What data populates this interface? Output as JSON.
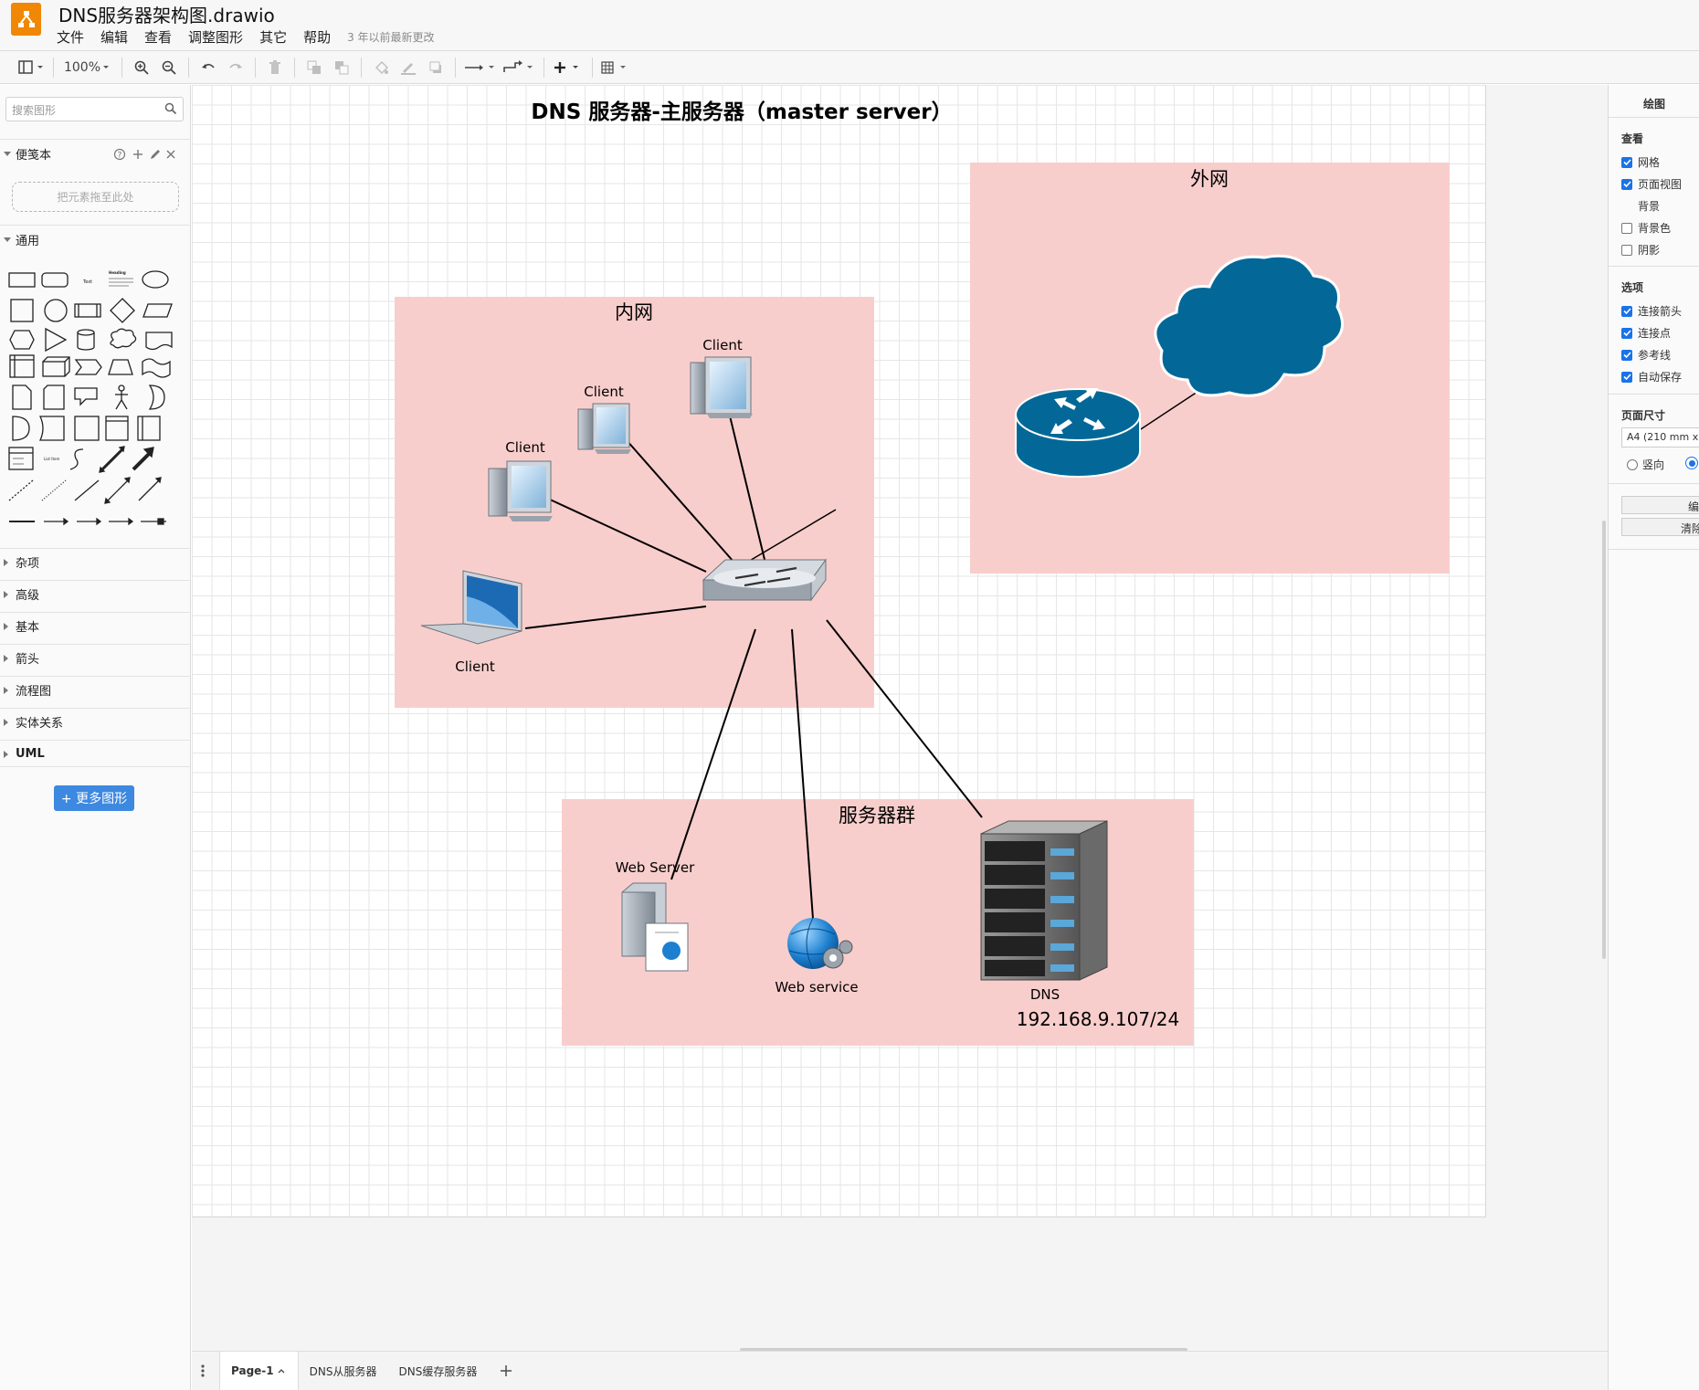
{
  "app": {
    "doc_title": "DNS服务器架构图.drawio",
    "menu": [
      "文件",
      "编辑",
      "查看",
      "调整图形",
      "其它",
      "帮助"
    ],
    "last_modified": "3 年以前最新更改"
  },
  "toolbar": {
    "zoom": "100%"
  },
  "sidebar": {
    "search_placeholder": "搜索图形",
    "scratchpad_label": "便笺本",
    "scratchpad_drop": "把元素拖至此处",
    "general_label": "通用",
    "sections": [
      "杂项",
      "高级",
      "基本",
      "箭头",
      "流程图",
      "实体关系",
      "UML"
    ],
    "more_shapes": "+ 更多图形",
    "text_shape_label": "Text",
    "heading_shape_label": "Heading",
    "list_shape_label": "List Item"
  },
  "diagram": {
    "title": "DNS 服务器-主服务器（master server）",
    "inner_net": "内网",
    "outer_net": "外网",
    "server_group": "服务器群",
    "client_label": "Client",
    "web_server_label": "Web Server",
    "web_service_label": "Web service",
    "dns_label": "DNS",
    "dns_ip": "192.168.9.107/24",
    "container_color": "#f8cecc",
    "device_color": "#036897"
  },
  "right_panel": {
    "title": "绘图",
    "view_heading": "查看",
    "view_options": [
      {
        "label": "网格",
        "checked": true
      },
      {
        "label": "页面视图",
        "checked": true
      }
    ],
    "background_label": "背景",
    "bg_options": [
      {
        "label": "背景色",
        "checked": false
      },
      {
        "label": "阴影",
        "checked": false
      }
    ],
    "options_heading": "选项",
    "options": [
      {
        "label": "连接箭头",
        "checked": true
      },
      {
        "label": "连接点",
        "checked": true
      },
      {
        "label": "参考线",
        "checked": true
      },
      {
        "label": "自动保存",
        "checked": true
      }
    ],
    "page_size_heading": "页面尺寸",
    "page_size_value": "A4 (210 mm x",
    "orientation_portrait": "竖向",
    "edit_button": "编",
    "clear_button": "清除"
  },
  "tabs": {
    "pages": [
      "Page-1",
      "DNS从服务器",
      "DNS缓存服务器"
    ],
    "active": "Page-1"
  }
}
